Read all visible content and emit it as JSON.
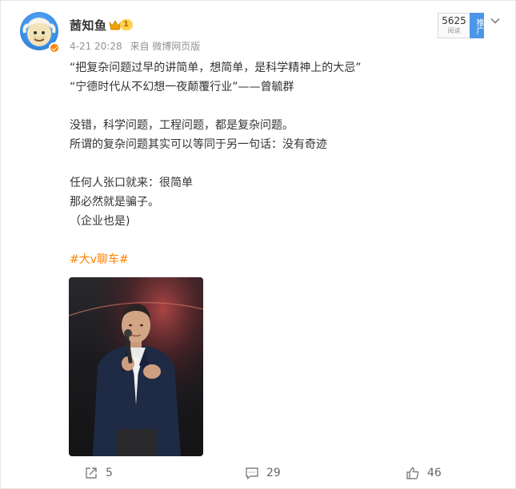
{
  "author": {
    "name": "莤知鱼",
    "level": "1",
    "level_icon": "crown-icon",
    "verified_badge": "verified-badge-icon"
  },
  "meta": {
    "time": "4-21 20:28",
    "source": "来自 微博网页版"
  },
  "read_count": {
    "value": "5625",
    "label": "阅读"
  },
  "promote_label": "推广",
  "post": {
    "lines": [
      "“把复杂问题过早的讲简单，想简单，是科学精神上的大忌”",
      "“宁德时代从不幻想一夜颠覆行业”——曾毓群",
      "",
      "没错，科学问题，工程问题，都是复杂问题。",
      "所谓的复杂问题其实可以等同于另一句话：没有奇迹",
      "",
      "任何人张口就来：很简单",
      "那必然就是骗子。",
      "（企业也是)"
    ],
    "hashtag": "#大v聊车#"
  },
  "actions": {
    "share": {
      "count": "5",
      "icon": "share-icon"
    },
    "comment": {
      "count": "29",
      "icon": "comment-icon"
    },
    "like": {
      "count": "46",
      "icon": "like-icon"
    }
  },
  "colors": {
    "accent": "#ff8200",
    "link_blue": "#4c96e8",
    "text": "#333333",
    "muted": "#939393"
  }
}
